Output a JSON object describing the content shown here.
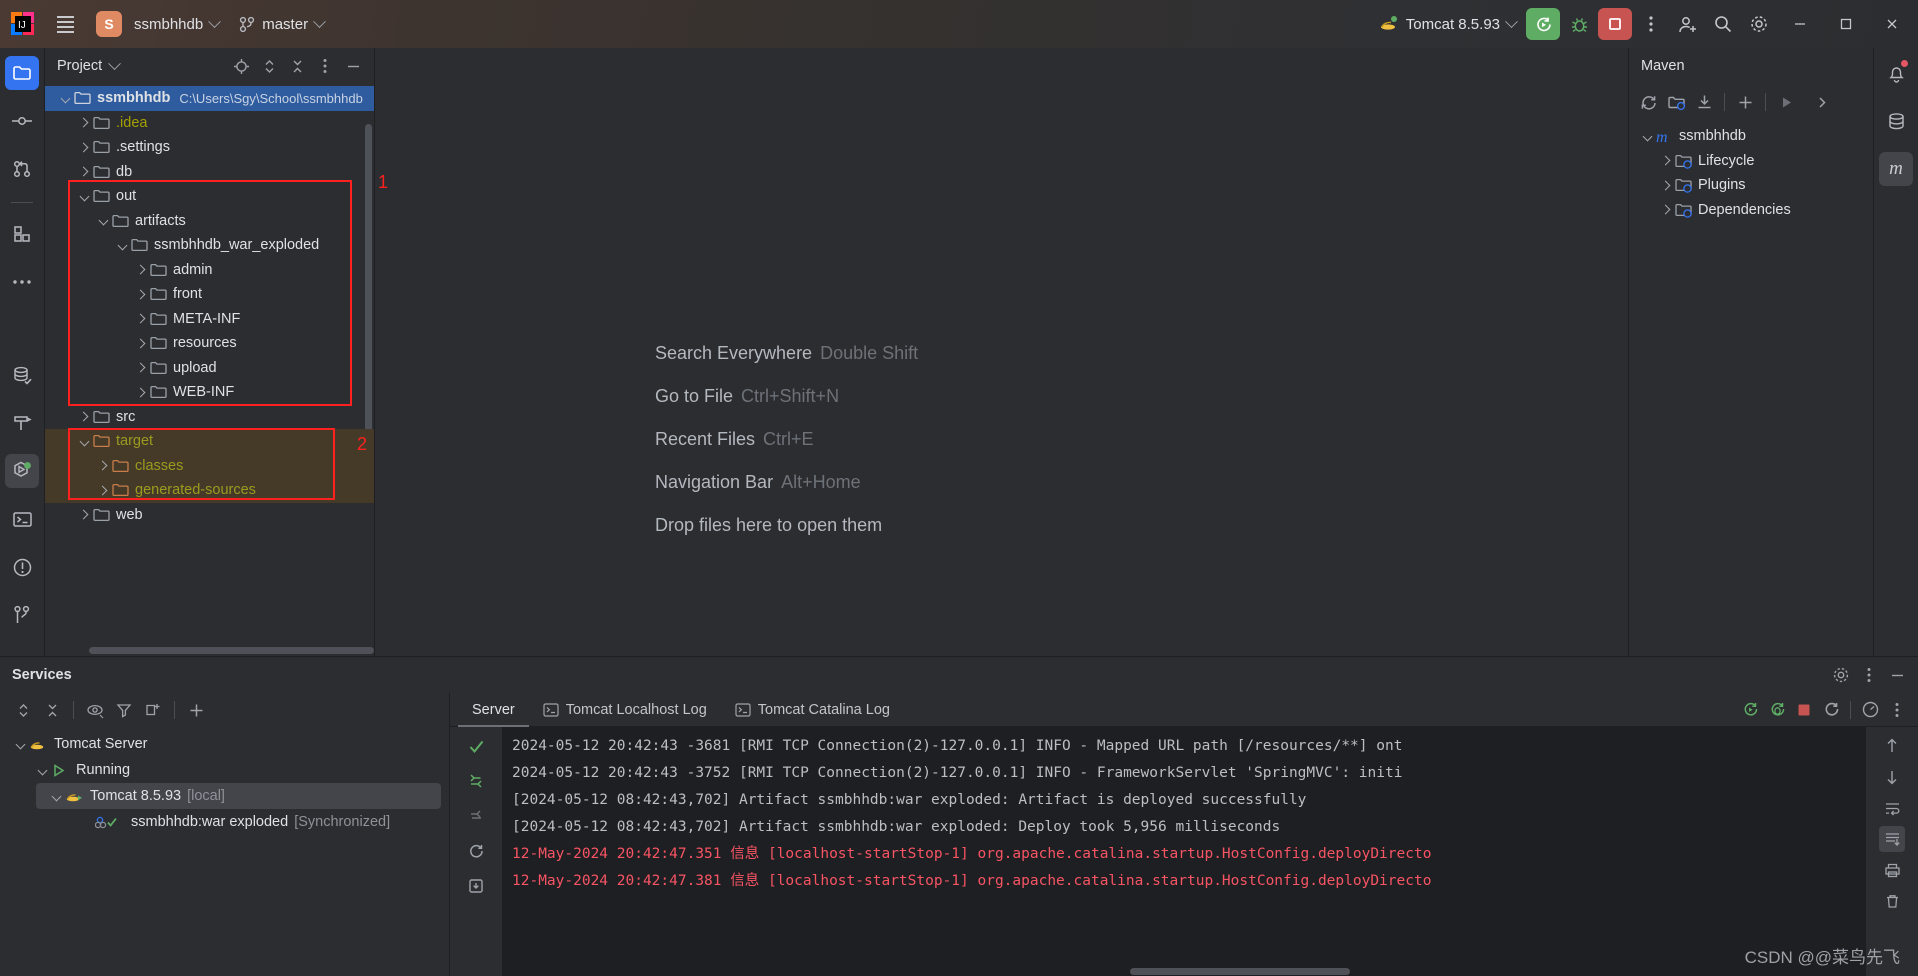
{
  "titlebar": {
    "menu_icon": "hamburger-icon",
    "project_initial": "S",
    "project_name": "ssmbhhdb",
    "vcs_branch": "master",
    "run_config": "Tomcat 8.5.93",
    "buttons": {
      "rerun": "rerun-icon",
      "debug": "debug-icon",
      "stop": "stop-icon",
      "more": "more-vertical-icon",
      "account": "account-icon",
      "search": "search-icon",
      "settings": "gear-icon",
      "minimize": "minimize-icon",
      "maximize": "maximize-icon",
      "close": "close-icon"
    }
  },
  "left_rail": {
    "items": [
      {
        "name": "project",
        "icon": "folder-icon",
        "active": true
      },
      {
        "name": "commit",
        "icon": "commit-icon",
        "active": false
      },
      {
        "name": "pull-requests",
        "icon": "pull-request-icon",
        "active": false
      },
      {
        "name": "structure",
        "icon": "structure-icon",
        "active": false
      },
      {
        "name": "more-tool-windows",
        "icon": "ellipsis-icon",
        "active": false
      }
    ],
    "bottom_items": [
      {
        "name": "database",
        "icon": "database-icon",
        "active": false
      },
      {
        "name": "build",
        "icon": "hammer-icon",
        "active": false
      },
      {
        "name": "services",
        "icon": "services-icon",
        "active": true
      },
      {
        "name": "terminal",
        "icon": "terminal-icon",
        "active": false
      },
      {
        "name": "problems",
        "icon": "warning-icon",
        "active": false
      },
      {
        "name": "version-control",
        "icon": "branch-icon",
        "active": false
      }
    ]
  },
  "project_panel": {
    "title": "Project",
    "toolbar": [
      {
        "name": "select-opened-file",
        "icon": "target-icon"
      },
      {
        "name": "expand-collapse",
        "icon": "updown-chevron-icon"
      },
      {
        "name": "collapse-all",
        "icon": "collapse-icon"
      },
      {
        "name": "options",
        "icon": "more-vertical-icon"
      },
      {
        "name": "hide",
        "icon": "minus-icon"
      }
    ],
    "tree": [
      {
        "label": "ssmbhhdb",
        "path": "C:\\Users\\Sgy\\School\\ssmbhhdb",
        "depth": 0,
        "state": "open",
        "selected": true,
        "color": "white",
        "bold": true
      },
      {
        "label": ".idea",
        "depth": 1,
        "state": "closed",
        "color": "yellow"
      },
      {
        "label": ".settings",
        "depth": 1,
        "state": "closed",
        "color": "white"
      },
      {
        "label": "db",
        "depth": 1,
        "state": "closed",
        "color": "white"
      },
      {
        "label": "out",
        "depth": 1,
        "state": "open",
        "color": "white"
      },
      {
        "label": "artifacts",
        "depth": 2,
        "state": "open",
        "color": "white"
      },
      {
        "label": "ssmbhhdb_war_exploded",
        "depth": 3,
        "state": "open",
        "color": "white"
      },
      {
        "label": "admin",
        "depth": 4,
        "state": "closed",
        "color": "white"
      },
      {
        "label": "front",
        "depth": 4,
        "state": "closed",
        "color": "white"
      },
      {
        "label": "META-INF",
        "depth": 4,
        "state": "closed",
        "color": "white"
      },
      {
        "label": "resources",
        "depth": 4,
        "state": "closed",
        "color": "white"
      },
      {
        "label": "upload",
        "depth": 4,
        "state": "closed",
        "color": "white"
      },
      {
        "label": "WEB-INF",
        "depth": 4,
        "state": "closed",
        "color": "white"
      },
      {
        "label": "src",
        "depth": 1,
        "state": "closed",
        "color": "white"
      },
      {
        "label": "target",
        "depth": 1,
        "state": "open",
        "color": "olive",
        "highlight": true
      },
      {
        "label": "classes",
        "depth": 2,
        "state": "closed",
        "color": "olive",
        "highlight": true
      },
      {
        "label": "generated-sources",
        "depth": 2,
        "state": "closed",
        "color": "olive",
        "highlight": true
      },
      {
        "label": "web",
        "depth": 1,
        "state": "closed",
        "color": "white"
      }
    ]
  },
  "editor": {
    "hints": [
      {
        "action": "Search Everywhere",
        "shortcut": "Double Shift"
      },
      {
        "action": "Go to File",
        "shortcut": "Ctrl+Shift+N"
      },
      {
        "action": "Recent Files",
        "shortcut": "Ctrl+E"
      },
      {
        "action": "Navigation Bar",
        "shortcut": "Alt+Home"
      },
      {
        "action": "Drop files here to open them",
        "shortcut": ""
      }
    ]
  },
  "maven_panel": {
    "title": "Maven",
    "toolbar": [
      {
        "name": "reload-all-maven-projects",
        "icon": "refresh-icon"
      },
      {
        "name": "add-maven-project",
        "icon": "add-folder-icon"
      },
      {
        "name": "download-sources",
        "icon": "download-icon"
      },
      {
        "name": "add-plugin",
        "icon": "plus-icon"
      },
      {
        "name": "run-maven-build",
        "icon": "play-icon"
      },
      {
        "name": "expand-toolbar",
        "icon": "chevron-right-icon"
      }
    ],
    "tree": [
      {
        "label": "ssmbhhdb",
        "depth": 0,
        "state": "open",
        "icon": "maven-m-icon"
      },
      {
        "label": "Lifecycle",
        "depth": 1,
        "state": "closed",
        "icon": "lifecycle-folder-icon"
      },
      {
        "label": "Plugins",
        "depth": 1,
        "state": "closed",
        "icon": "plugins-folder-icon"
      },
      {
        "label": "Dependencies",
        "depth": 1,
        "state": "closed",
        "icon": "dependencies-folder-icon"
      }
    ]
  },
  "right_rail": {
    "items": [
      {
        "name": "notifications",
        "icon": "bell-icon",
        "badge": true
      },
      {
        "name": "database",
        "icon": "database-icon"
      },
      {
        "name": "maven",
        "icon": "maven-m-icon",
        "active": true
      }
    ]
  },
  "services": {
    "title": "Services",
    "head_actions": [
      {
        "name": "settings",
        "icon": "gear-icon"
      },
      {
        "name": "options",
        "icon": "more-vertical-icon"
      },
      {
        "name": "hide",
        "icon": "minus-icon"
      }
    ],
    "left_toolbar": [
      {
        "name": "expand-collapse",
        "icon": "updown-chevron-icon"
      },
      {
        "name": "collapse-all",
        "icon": "collapse-icon"
      },
      {
        "name": "show-hide",
        "icon": "eye-icon"
      },
      {
        "name": "filter",
        "icon": "filter-icon"
      },
      {
        "name": "group-by",
        "icon": "group-icon"
      },
      {
        "name": "add-service",
        "icon": "plus-icon"
      }
    ],
    "tree": [
      {
        "label": "Tomcat Server",
        "depth": 0,
        "state": "open",
        "icon": "tomcat-icon"
      },
      {
        "label": "Running",
        "depth": 1,
        "state": "open",
        "icon": "play-green-icon"
      },
      {
        "label": "Tomcat 8.5.93",
        "suffix": "[local]",
        "depth": 2,
        "state": "open",
        "icon": "tomcat-run-icon",
        "selected": true
      },
      {
        "label": "ssmbhhdb:war exploded",
        "suffix": "[Synchronized]",
        "depth": 3,
        "state": "leaf",
        "icon": "artifact-check-icon"
      }
    ],
    "tabs": [
      {
        "label": "Server",
        "icon": "",
        "active": true
      },
      {
        "label": "Tomcat Localhost Log",
        "icon": "console-icon",
        "active": false
      },
      {
        "label": "Tomcat Catalina Log",
        "icon": "console-icon",
        "active": false
      }
    ],
    "tab_actions": [
      {
        "name": "rerun",
        "icon": "rerun-icon"
      },
      {
        "name": "rerun-debug",
        "icon": "rerun-debug-icon"
      },
      {
        "name": "stop",
        "icon": "stop-icon"
      },
      {
        "name": "restart",
        "icon": "restart-icon"
      },
      {
        "name": "profiler",
        "icon": "profiler-icon"
      },
      {
        "name": "more",
        "icon": "more-vertical-icon"
      }
    ],
    "console_gutter": [
      {
        "name": "status-ok",
        "icon": "check-icon"
      },
      {
        "name": "step-over",
        "icon": "step-over-icon"
      },
      {
        "name": "step-into",
        "icon": "step-into-icon"
      },
      {
        "name": "rerun-circular",
        "icon": "refresh-icon"
      },
      {
        "name": "update-app",
        "icon": "update-icon"
      }
    ],
    "console_right_actions": [
      {
        "name": "scroll-up",
        "icon": "arrow-up-icon"
      },
      {
        "name": "scroll-down",
        "icon": "arrow-down-icon"
      },
      {
        "name": "soft-wrap",
        "icon": "wrap-icon"
      },
      {
        "name": "scroll-to-end",
        "icon": "scroll-end-icon"
      },
      {
        "name": "print",
        "icon": "print-icon"
      },
      {
        "name": "clear-all",
        "icon": "trash-icon"
      }
    ],
    "console_lines": [
      {
        "text": "2024-05-12 20:42:43 -3681 [RMI TCP Connection(2)-127.0.0.1] INFO    - Mapped URL path [/resources/**] ont",
        "level": "info"
      },
      {
        "text": "2024-05-12 20:42:43 -3752 [RMI TCP Connection(2)-127.0.0.1] INFO    - FrameworkServlet 'SpringMVC': initi",
        "level": "info"
      },
      {
        "text": "[2024-05-12 08:42:43,702] Artifact ssmbhhdb:war exploded: Artifact is deployed successfully",
        "level": "info"
      },
      {
        "text": "[2024-05-12 08:42:43,702] Artifact ssmbhhdb:war exploded: Deploy took 5,956 milliseconds",
        "level": "info"
      },
      {
        "text": "12-May-2024 20:42:47.351 信息 [localhost-startStop-1] org.apache.catalina.startup.HostConfig.deployDirecto",
        "level": "error"
      },
      {
        "text": "12-May-2024 20:42:47.381 信息 [localhost-startStop-1] org.apache.catalina.startup.HostConfig.deployDirecto",
        "level": "error"
      }
    ]
  },
  "annotations": [
    {
      "number": "1",
      "color": "#ff2020"
    },
    {
      "number": "2",
      "color": "#ff2020"
    }
  ],
  "watermark": "CSDN @@菜鸟先飞"
}
